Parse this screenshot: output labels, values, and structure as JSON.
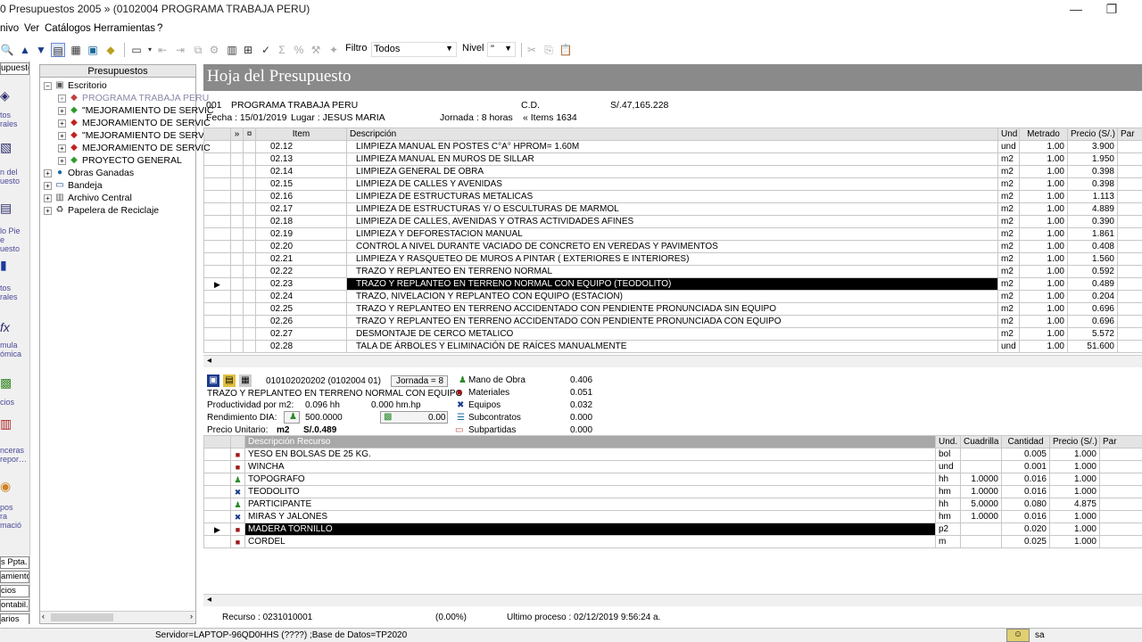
{
  "window": {
    "title": "0 Presupuestos 2005 » (0102004 PROGRAMA TRABAJA PERU)",
    "minimize": "—",
    "restore": "❐"
  },
  "menu": [
    "nivo",
    "Ver",
    "Catálogos",
    "Herramientas",
    "?"
  ],
  "toolbar": {
    "filtro_label": "Filtro",
    "filtro_value": "Todos",
    "nivel_label": "Nivel",
    "nivel_value": "\""
  },
  "left_strip": {
    "header": "upuestos",
    "labels": [
      "tos\nrales",
      "n del\nuesto",
      "lo Pie\ne\nuesto",
      "tos\nrales",
      "mula\nómica",
      "cios",
      "nceras\nrepor…",
      "pos\nra\nmació"
    ],
    "tabs": [
      "s Ppta.",
      "amiento",
      "cios",
      "ontabil.",
      "arios"
    ]
  },
  "tree": {
    "header": "Presupuestos",
    "root": "Escritorio",
    "items": [
      {
        "label": "PROGRAMA TRABAJA PERU",
        "level": 2,
        "dim": true
      },
      {
        "label": "\"MEJORAMIENTO DE SERVIC",
        "level": 2
      },
      {
        "label": "MEJORAMIENTO DE SERVIC",
        "level": 2
      },
      {
        "label": "\"MEJORAMIENTO DE SERVIC",
        "level": 2
      },
      {
        "label": "MEJORAMIENTO DE SERVIC",
        "level": 2
      },
      {
        "label": "PROYECTO GENERAL",
        "level": 2
      },
      {
        "label": "Obras Ganadas",
        "level": 1
      },
      {
        "label": "Bandeja",
        "level": 1
      },
      {
        "label": "Archivo Central",
        "level": 1
      },
      {
        "label": "Papelera de Reciclaje",
        "level": 1
      }
    ]
  },
  "main": {
    "title": "Hoja del Presupuesto",
    "code": "001",
    "name": "PROGRAMA TRABAJA PERU",
    "cd_label": "C.D.",
    "cd_value": "S/.47,165.228",
    "fecha": "Fecha :  15/01/2019",
    "lugar": "Lugar :  JESUS MARIA",
    "jornada": "Jornada :  8   horas",
    "items": "« Items 1634"
  },
  "grid": {
    "headers": [
      "»",
      "¤",
      "Item",
      "Descripción",
      "Und",
      "Metrado",
      "Precio (S/.)",
      "Par"
    ],
    "rows": [
      [
        "02.12",
        "LIMPIEZA MANUAL EN POSTES C°A° HPROM= 1.60M",
        "und",
        "1.00",
        "3.900"
      ],
      [
        "02.13",
        "LIMPIEZA MANUAL EN MUROS DE SILLAR",
        "m2",
        "1.00",
        "1.950"
      ],
      [
        "02.14",
        "LIMPIEZA GENERAL DE OBRA",
        "m2",
        "1.00",
        "0.398"
      ],
      [
        "02.15",
        "LIMPIEZA DE CALLES  Y  AVENIDAS",
        "m2",
        "1.00",
        "0.398"
      ],
      [
        "02.16",
        "LIMPIEZA DE ESTRUCTURAS METALICAS",
        "m2",
        "1.00",
        "1.113"
      ],
      [
        "02.17",
        "LIMPIEZA DE ESTRUCTURAS Y/ O ESCULTURAS DE MARMOL",
        "m2",
        "1.00",
        "4.889"
      ],
      [
        "02.18",
        "LIMPIEZA DE CALLES, AVENIDAS Y OTRAS ACTIVIDADES AFINES",
        "m2",
        "1.00",
        "0.390"
      ],
      [
        "02.19",
        "LIMPIEZA Y DEFORESTACION MANUAL",
        "m2",
        "1.00",
        "1.861"
      ],
      [
        "02.20",
        "CONTROL A NIVEL DURANTE VACIADO DE CONCRETO EN VEREDAS Y PAVIMENTOS",
        "m2",
        "1.00",
        "0.408"
      ],
      [
        "02.21",
        "LIMPIEZA Y RASQUETEO DE MUROS A PINTAR ( EXTERIORES E INTERIORES)",
        "m2",
        "1.00",
        "1.560"
      ],
      [
        "02.22",
        "TRAZO Y REPLANTEO EN TERRENO NORMAL",
        "m2",
        "1.00",
        "0.592"
      ],
      [
        "02.23",
        "TRAZO Y REPLANTEO EN TERRENO NORMAL CON EQUIPO (TEODOLITO)",
        "m2",
        "1.00",
        "0.489"
      ],
      [
        "02.24",
        "TRAZO, NIVELACION Y REPLANTEO CON EQUIPO (ESTACION)",
        "m2",
        "1.00",
        "0.204"
      ],
      [
        "02.25",
        "TRAZO Y REPLANTEO EN TERRENO ACCIDENTADO CON PENDIENTE PRONUNCIADA SIN EQUIPO",
        "m2",
        "1.00",
        "0.696"
      ],
      [
        "02.26",
        "TRAZO Y REPLANTEO EN TERRENO ACCIDENTADO CON PENDIENTE PRONUNCIADA CON EQUIPO",
        "m2",
        "1.00",
        "0.696"
      ],
      [
        "02.27",
        "DESMONTAJE DE CERCO METALICO",
        "m2",
        "1.00",
        "5.572"
      ],
      [
        "02.28",
        "TALA DE ÁRBOLES Y ELIMINACIÓN DE RAÍCES MANUALMENTE",
        "und",
        "1.00",
        "51.600"
      ]
    ],
    "selected_index": 11
  },
  "detail": {
    "code": "010102020202 (0102004 01)",
    "jornada": "Jornada = 8",
    "desc": "TRAZO Y REPLANTEO EN TERRENO NORMAL CON EQUIPO",
    "prod_label": "Productividad por m2:",
    "prod_hh": "0.096 hh",
    "prod_hm": "0.000 hm.hp",
    "rend_label": "Rendimiento DIA:",
    "rend_value": "500.0000",
    "money_value": "0.00",
    "pu_label": "Precio Unitario:",
    "pu_unit": "m2",
    "pu_value": "S/.0.489",
    "breakdown": [
      {
        "label": "Mano de Obra",
        "value": "0.406"
      },
      {
        "label": "Materiales",
        "value": "0.051"
      },
      {
        "label": "Equipos",
        "value": "0.032"
      },
      {
        "label": "Subcontratos",
        "value": "0.000"
      },
      {
        "label": "Subpartidas",
        "value": "0.000"
      }
    ]
  },
  "resources": {
    "headers": [
      "Descripción Recurso",
      "Und.",
      "Cuadrilla",
      "Cantidad",
      "Precio (S/.)",
      "Par"
    ],
    "rows": [
      {
        "type": "mat",
        "desc": "YESO EN BOLSAS DE 25 KG.",
        "und": "bol",
        "cuad": "",
        "cant": "0.005",
        "precio": "1.000"
      },
      {
        "type": "mat",
        "desc": "WINCHA",
        "und": "und",
        "cuad": "",
        "cant": "0.001",
        "precio": "1.000"
      },
      {
        "type": "mo",
        "desc": "TOPOGRAFO",
        "und": "hh",
        "cuad": "1.0000",
        "cant": "0.016",
        "precio": "1.000"
      },
      {
        "type": "eq",
        "desc": "TEODOLITO",
        "und": "hm",
        "cuad": "1.0000",
        "cant": "0.016",
        "precio": "1.000"
      },
      {
        "type": "mo",
        "desc": "PARTICIPANTE",
        "und": "hh",
        "cuad": "5.0000",
        "cant": "0.080",
        "precio": "4.875"
      },
      {
        "type": "eq",
        "desc": "MIRAS Y JALONES",
        "und": "hm",
        "cuad": "1.0000",
        "cant": "0.016",
        "precio": "1.000"
      },
      {
        "type": "mat",
        "desc": "MADERA TORNILLO",
        "und": "p2",
        "cuad": "",
        "cant": "0.020",
        "precio": "1.000"
      },
      {
        "type": "mat",
        "desc": "CORDEL",
        "und": "m",
        "cuad": "",
        "cant": "0.025",
        "precio": "1.000"
      }
    ],
    "selected_index": 6
  },
  "status": {
    "recurso": "Recurso :  0231010001",
    "percent": "(0.00%)",
    "ultimo": "Ultimo proceso : 02/12/2019 9:56:24 a.",
    "server": "Servidor=LAPTOP-96QD0HHS (????) ;Base de Datos=TP2020",
    "user": "sa"
  }
}
